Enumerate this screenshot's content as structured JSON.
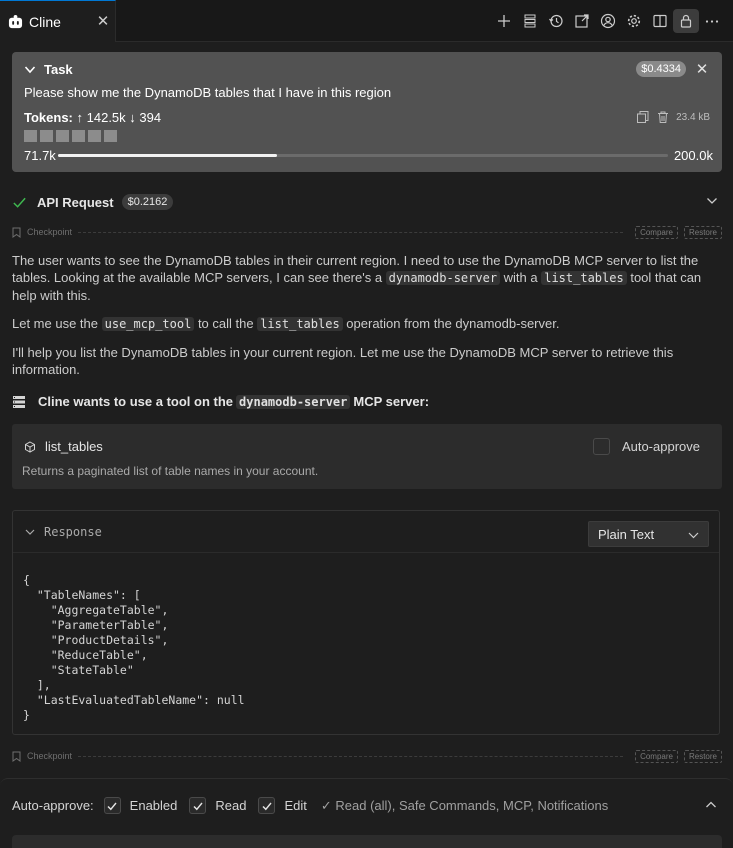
{
  "tab": {
    "title": "Cline"
  },
  "toolbar": {
    "icons": [
      "plus-icon",
      "server-icon",
      "history-icon",
      "popout-icon",
      "account-icon",
      "settings-icon",
      "split-icon",
      "lock-icon",
      "more-icon"
    ]
  },
  "task": {
    "label": "Task",
    "cost": "$0.4334",
    "description": "Please show me the DynamoDB tables that I have in this region",
    "tokens_label": "Tokens:",
    "tokens_in": "↑ 142.5k",
    "tokens_out": "↓ 394",
    "size": "23.4 kB",
    "context_used": "71.7k",
    "context_max": "200.0k",
    "context_fraction": 0.3585
  },
  "api_request": {
    "label": "API Request",
    "cost": "$0.2162"
  },
  "checkpoint": {
    "label": "Checkpoint",
    "compare": "Compare",
    "restore": "Restore"
  },
  "messages": {
    "p1_a": "The user wants to see the DynamoDB tables in their current region. I need to use the DynamoDB MCP server to list the tables. Looking at the available MCP servers, I can see there's a ",
    "p1_code1": "dynamodb-server",
    "p1_b": " with a ",
    "p1_code2": "list_tables",
    "p1_c": " tool that can help with this.",
    "p2_a": "Let me use the ",
    "p2_code1": "use_mcp_tool",
    "p2_b": " to call the ",
    "p2_code2": "list_tables",
    "p2_c": " operation from the dynamodb-server.",
    "p3": "I'll help you list the DynamoDB tables in your current region. Let me use the DynamoDB MCP server to retrieve this information."
  },
  "tool_use": {
    "prefix": "Cline wants to use a tool on the",
    "server": "dynamodb-server",
    "suffix": "MCP server:",
    "tool_name": "list_tables",
    "tool_desc": "Returns a paginated list of table names in your account.",
    "auto_approve": "Auto-approve"
  },
  "response": {
    "title": "Response",
    "format": "Plain Text",
    "body": "{\n  \"TableNames\": [\n    \"AggregateTable\",\n    \"ParameterTable\",\n    \"ProductDetails\",\n    \"ReduceTable\",\n    \"StateTable\"\n  ],\n  \"LastEvaluatedTableName\": null\n}"
  },
  "auto_approve_bar": {
    "label": "Auto-approve:",
    "enabled": "Enabled",
    "read": "Read",
    "edit": "Edit",
    "summary": "✓ Read (all), Safe Commands, MCP, Notifications"
  }
}
